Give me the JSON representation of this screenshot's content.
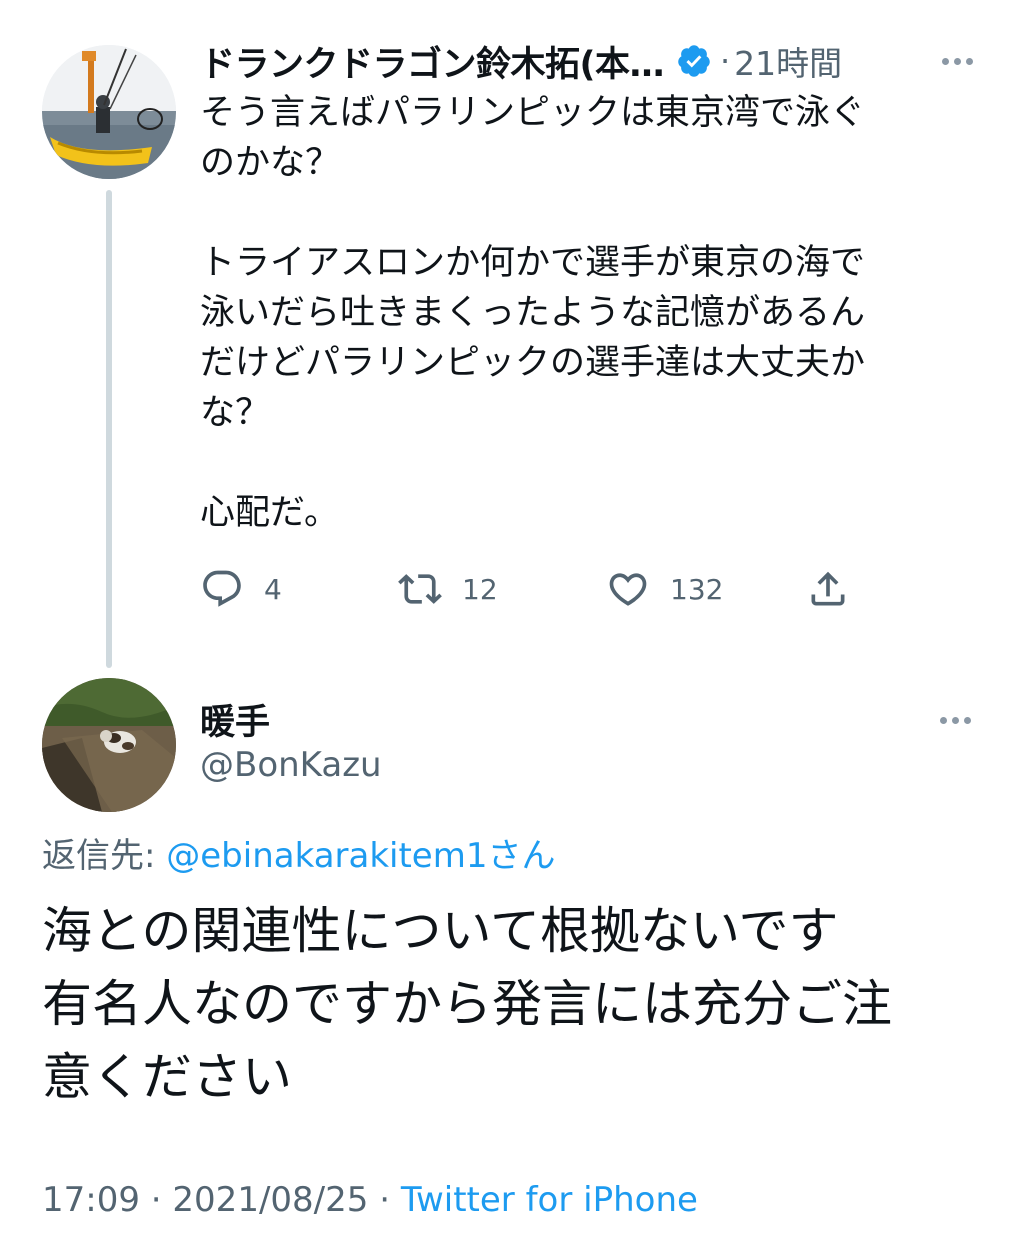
{
  "parent_tweet": {
    "display_name": "ドランクドラゴン鈴木拓(本…",
    "verified": true,
    "separator": "·",
    "relative_time": "21時間",
    "text": "そう言えばパラリンピックは東京湾で泳ぐ\nのかな？\n\nトライアスロンか何かで選手が東京の海で\n泳いだら吐きまくったような記憶があるん\nだけどパラリンピックの選手達は大丈夫か\nな？\n\n心配だ。",
    "actions": {
      "reply_icon": "reply-icon",
      "reply_count": "4",
      "retweet_icon": "retweet-icon",
      "retweet_count": "12",
      "like_icon": "heart-icon",
      "like_count": "132",
      "share_icon": "share-icon"
    }
  },
  "reply_tweet": {
    "display_name": "暖手",
    "handle": "@BonKazu",
    "replying_to_label": "返信先: ",
    "replying_to_mention": "@ebinakarakitem1さん",
    "text": "海との関連性について根拠ないです\n有名人なのですから発言には充分ご注\n意ください",
    "time": "17:09",
    "separator": " · ",
    "date": "2021/08/25",
    "source": "Twitter for iPhone"
  },
  "colors": {
    "text_primary": "#0f1419",
    "text_secondary": "#536471",
    "link": "#1d9bf0",
    "verified": "#1d9bf0",
    "thread_line": "#cfd9de"
  }
}
